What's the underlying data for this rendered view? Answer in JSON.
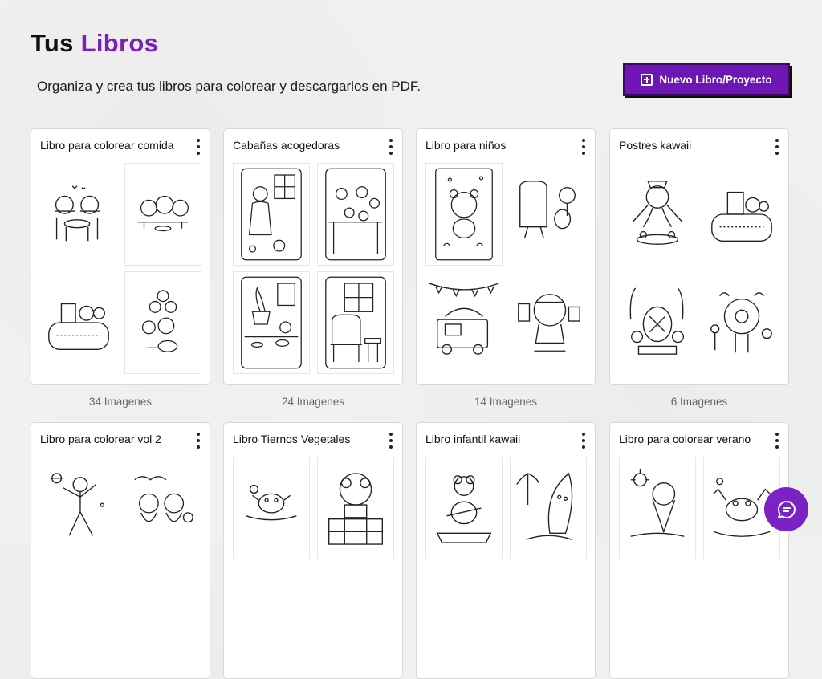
{
  "header": {
    "title_plain": "Tus",
    "title_accent": "Libros",
    "subtitle": "Organiza y crea tus libros para colorear y descargarlos en PDF.",
    "new_button_label": "Nuevo Libro/Proyecto",
    "new_button_icon": "plus-square-icon"
  },
  "books": [
    {
      "title": "Libro para colorear comida",
      "count": "34 Imagenes"
    },
    {
      "title": "Cabañas acogedoras",
      "count": "24 Imagenes"
    },
    {
      "title": "Libro para niños",
      "count": "14 Imagenes"
    },
    {
      "title": "Postres kawaii",
      "count": "6 Imagenes"
    },
    {
      "title": "Libro para colorear vol 2"
    },
    {
      "title": "Libro Tiernos Vegetales"
    },
    {
      "title": "Libro infantil kawaii"
    },
    {
      "title": "Libro para colorear verano"
    }
  ],
  "chat": {
    "icon": "chat-bubble-icon"
  },
  "colors": {
    "accent": "#7a1fb8",
    "button": "#6e16b3"
  }
}
